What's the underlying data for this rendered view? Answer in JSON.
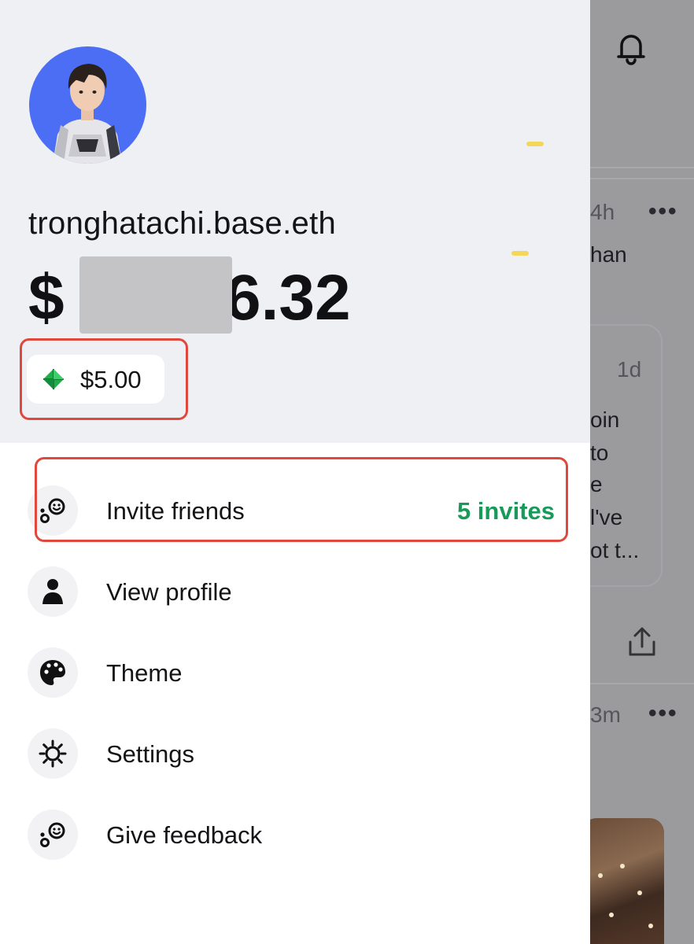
{
  "feed": {
    "items": [
      {
        "time": "4h",
        "snippet": "han"
      },
      {
        "time": "1d",
        "lines": [
          "oin",
          " to",
          "e",
          "l've",
          "ot t..."
        ]
      },
      {
        "time": "3m"
      }
    ]
  },
  "profile": {
    "username": "tronghatachi.base.eth",
    "balance_prefix": "$",
    "balance_visible": "6.32",
    "credits": "$5.00"
  },
  "menu": {
    "items": [
      {
        "label": "Invite friends",
        "icon": "invite-icon",
        "badge": "5 invites"
      },
      {
        "label": "View profile",
        "icon": "person-icon"
      },
      {
        "label": "Theme",
        "icon": "palette-icon"
      },
      {
        "label": "Settings",
        "icon": "gear-icon"
      },
      {
        "label": "Give feedback",
        "icon": "feedback-icon"
      }
    ]
  },
  "colors": {
    "accent_green": "#1a9a5a",
    "highlight_red": "#e0483d",
    "avatar_bg": "#4b6ef5"
  }
}
